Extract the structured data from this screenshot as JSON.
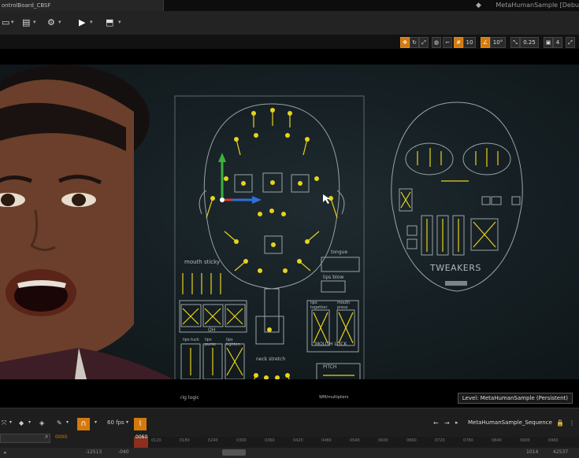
{
  "window": {
    "tab_title": "ontrolBoard_CBSF",
    "project_title": "MetaHumanSample [Debu",
    "logo_icon": "unreal-logo-icon"
  },
  "toolbar": {
    "icons": [
      "save-icon",
      "browse-icon",
      "settings-icon",
      "play-icon",
      "launch-icon"
    ]
  },
  "viewport_controls": {
    "grid_snap": "10",
    "rotation_snap": "10°",
    "scale_snap": "0.25",
    "camera_speed": "4"
  },
  "board": {
    "left_panel_labels": {
      "mouth_sticky": "mouth sticky",
      "tongue": "tongue",
      "lips_blow": "lips blow",
      "lips_together": "lips together",
      "mouth_press": "mouth press",
      "oh": "OH",
      "lips_tuck": "lips tuck",
      "lips_purse": "lips purse",
      "lips_tighten": "lips tighten",
      "mouth_lock": "MOUTH LOCK",
      "neck_stretch": "neck stretch",
      "pitch": "PITCH",
      "eye_rig_logic": "rig logic",
      "multipliers": "WM/multipliers"
    },
    "right_panel_labels": {
      "tweakers": "TWEAKERS"
    }
  },
  "level_label": "Level: MetaHumanSample (Persistent)",
  "sequencer": {
    "fps": "60 fps",
    "current_frame": "0060",
    "start_frame": "0000",
    "sequence_name": "MetaHumanSample_Sequence",
    "ticks": [
      "0000",
      "0060",
      "0120",
      "0180",
      "0240",
      "0300",
      "0360",
      "0420",
      "0480",
      "0540",
      "0600",
      "0660",
      "0720",
      "0780",
      "0840",
      "0900",
      "0960"
    ],
    "range_start": "-12513",
    "range_low": "-040",
    "range_end": "42537",
    "range_high": "1014"
  }
}
